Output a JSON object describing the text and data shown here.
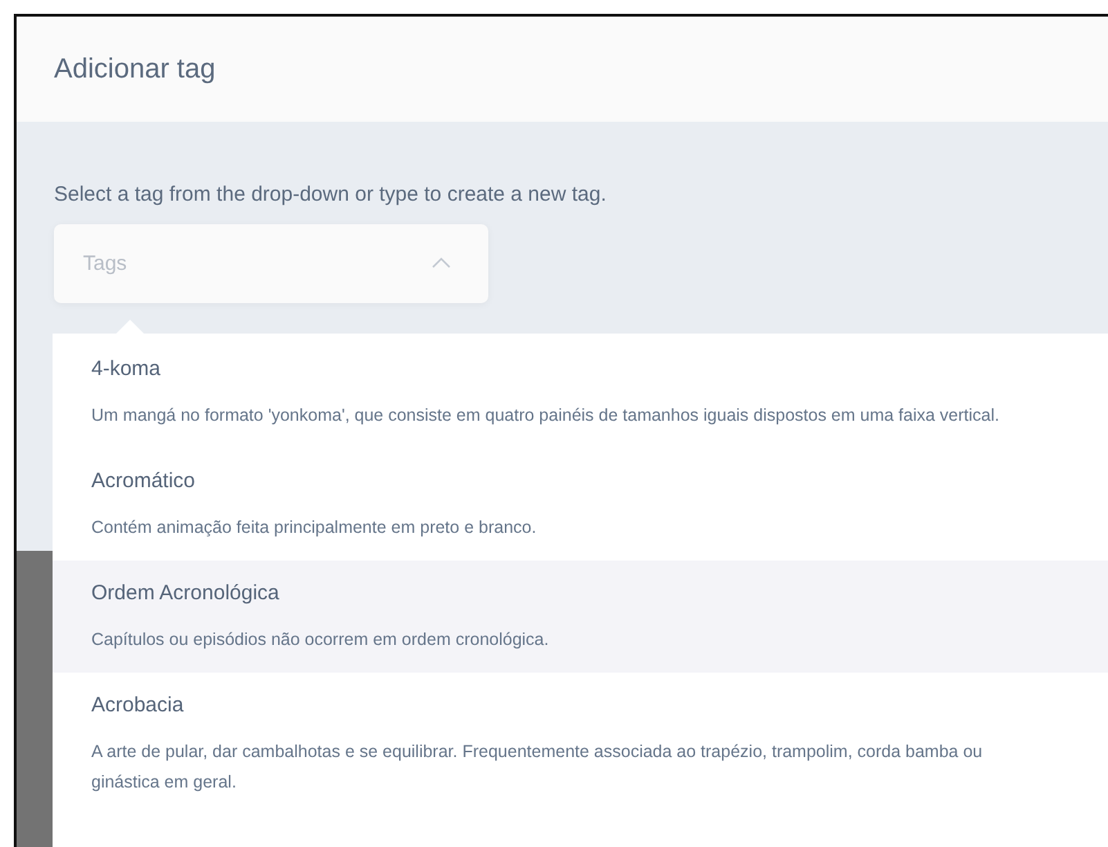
{
  "dialog": {
    "title": "Adicionar tag"
  },
  "instructions": "Select a tag from the drop-down or type to create a new tag.",
  "tag_field": {
    "placeholder": "Tags",
    "expanded": true
  },
  "options": [
    {
      "name": "4-koma",
      "description": "Um mangá no formato 'yonkoma', que consiste em quatro painéis de tamanhos iguais dispostos em uma faixa vertical.",
      "selected": false
    },
    {
      "name": "Acromático",
      "description": "Contém animação feita principalmente em preto e branco.",
      "selected": false
    },
    {
      "name": "Ordem Acronológica",
      "description": "Capítulos ou episódios não ocorrem em ordem cronológica.",
      "selected": true
    },
    {
      "name": "Acrobacia",
      "description": "A arte de pular, dar cambalhotas e se equilibrar. Frequentemente associada ao trapézio, trampolim, corda bamba ou ginástica em geral.",
      "selected": false
    }
  ]
}
